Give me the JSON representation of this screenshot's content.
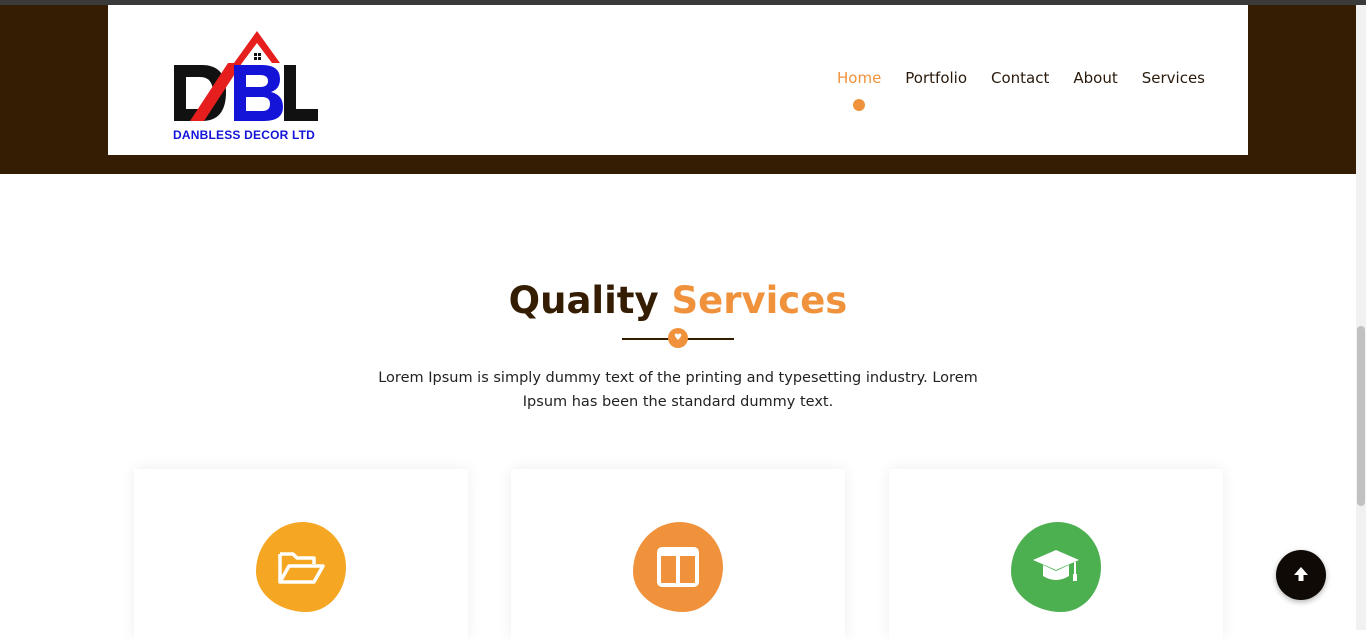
{
  "brand": {
    "caption": "DANBLESS DECOR LTD",
    "letters": "DBL"
  },
  "nav": [
    {
      "label": "Home",
      "active": true
    },
    {
      "label": "Portfolio",
      "active": false
    },
    {
      "label": "Contact",
      "active": false
    },
    {
      "label": "About",
      "active": false
    },
    {
      "label": "Services",
      "active": false
    }
  ],
  "section": {
    "title_part1": "Quality",
    "title_part2": "Services",
    "divider_icon": "heart-icon",
    "intro": "Lorem Ipsum is simply dummy text of the printing and typesetting industry. Lorem Ipsum has been the standard dummy text."
  },
  "cards": [
    {
      "icon": "folder-open-icon",
      "color": "#f5a623"
    },
    {
      "icon": "columns-icon",
      "color": "#f0923c"
    },
    {
      "icon": "graduation-cap-icon",
      "color": "#4caf50"
    }
  ],
  "back_to_top_icon": "arrow-up-icon",
  "colors": {
    "brown": "#351d03",
    "accent": "#f0923c",
    "brand_blue": "#1414d9",
    "brand_red": "#e61e1e"
  }
}
